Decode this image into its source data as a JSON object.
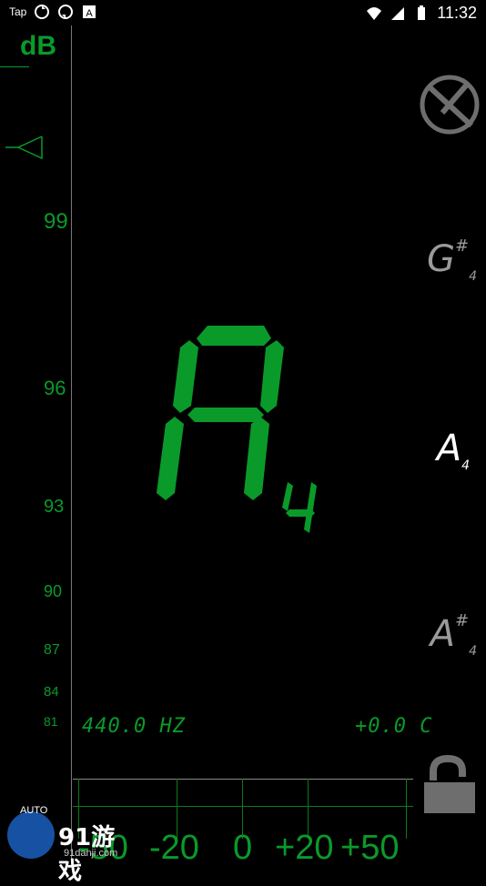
{
  "status_bar": {
    "left_text": "Tap",
    "time": "11:32"
  },
  "meter": {
    "unit": "dB",
    "ticks": [
      {
        "label": "99"
      },
      {
        "label": "96"
      },
      {
        "label": "93"
      },
      {
        "label": "90"
      },
      {
        "label": "87"
      },
      {
        "label": "84"
      },
      {
        "label": "81"
      }
    ]
  },
  "tuner": {
    "note": "A",
    "octave": "4",
    "frequency": "440.0 HZ",
    "cents": "+0.0 C"
  },
  "side_notes": [
    {
      "note": "G",
      "accidental": "#",
      "octave": "4"
    },
    {
      "note": "A",
      "accidental": "",
      "octave": "4"
    },
    {
      "note": "A",
      "accidental": "#",
      "octave": "4"
    }
  ],
  "scale": {
    "labels": [
      "-50",
      "-20",
      "0",
      "+20",
      "+50"
    ]
  },
  "watermark": {
    "text": "AUTO",
    "brand": "91游戏",
    "site": "91danji.com"
  },
  "colors": {
    "accent": "#0a9a2a",
    "active_note": "#ffffff",
    "inactive_note": "#9a9a9a",
    "icon_grey": "#6e6e6e"
  }
}
